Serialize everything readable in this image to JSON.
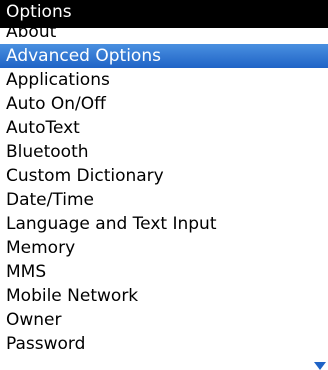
{
  "header": {
    "title": "Options"
  },
  "menu": {
    "items": [
      {
        "label": "About"
      },
      {
        "label": "Advanced Options"
      },
      {
        "label": "Applications"
      },
      {
        "label": "Auto On/Off"
      },
      {
        "label": "AutoText"
      },
      {
        "label": "Bluetooth"
      },
      {
        "label": "Custom Dictionary"
      },
      {
        "label": "Date/Time"
      },
      {
        "label": "Language and Text Input"
      },
      {
        "label": "Memory"
      },
      {
        "label": "MMS"
      },
      {
        "label": "Mobile Network"
      },
      {
        "label": "Owner"
      },
      {
        "label": "Password"
      }
    ],
    "selected_label": "Advanced Options"
  },
  "colors": {
    "title_background": "#000000",
    "selection_top": "#4a90e0",
    "selection_bottom": "#1f63c6"
  },
  "icons": {
    "scroll_indicator": "chevron-down-icon"
  }
}
